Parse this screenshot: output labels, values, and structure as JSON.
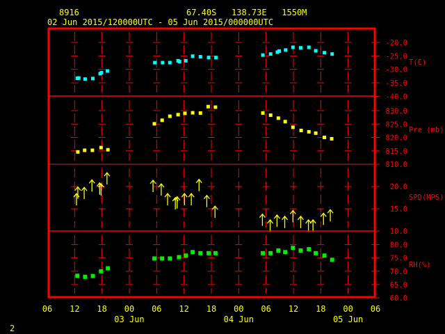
{
  "header": {
    "station": "8916",
    "location": "67.40S   138.73E   1550M",
    "period": "02 Jun 2015/120000UTC - 05 Jun 2015/000000UTC"
  },
  "footer": {
    "page": "2"
  },
  "colors": {
    "frame": "#ff0000",
    "temp": "#00ffff",
    "pres": "#ffff00",
    "wind": "#ffff00",
    "rh": "#00ee00",
    "text": "#ffff00"
  },
  "chart_data": {
    "type": "scatter",
    "title": "8916  67.40S 138.73E 1550M",
    "x_unit": "hours since 02 Jun 2015 06 UTC",
    "xlim": [
      0,
      72
    ],
    "x_ticks": [
      "06",
      "12",
      "18",
      "00",
      "06",
      "12",
      "18",
      "00",
      "06",
      "12",
      "18",
      "00",
      "06"
    ],
    "date_labels": [
      {
        "hour": 18,
        "label": "03 Jun"
      },
      {
        "hour": 42,
        "label": "04 Jun"
      },
      {
        "hour": 66,
        "label": "05 Jun"
      }
    ],
    "panels": [
      {
        "key": "temp",
        "label": "T(C)",
        "ylim": [
          -40,
          -17.5
        ],
        "ticks": [
          "-20.0",
          "-25.0",
          "-30.0",
          "-35.0",
          "-40.0"
        ],
        "tick_values": [
          -20,
          -25,
          -30,
          -35,
          -40
        ],
        "x": [
          6.6,
          6.9,
          8.3,
          10.0,
          11.6,
          11.9,
          13.2,
          23.6,
          25.3,
          26.9,
          28.7,
          29.0,
          30.4,
          31.9,
          33.6,
          35.4,
          37.0,
          47.3,
          49.0,
          50.5,
          50.9,
          52.3,
          53.9,
          55.6,
          57.4,
          58.9,
          60.8,
          62.5
        ],
        "y": [
          -33.3,
          -33.2,
          -33.6,
          -33.4,
          -31.6,
          -31.2,
          -30.6,
          -27.5,
          -27.5,
          -27.5,
          -26.8,
          -27.1,
          -26.8,
          -25.1,
          -25.3,
          -25.6,
          -25.6,
          -24.7,
          -24.3,
          -23.6,
          -23.2,
          -22.8,
          -21.8,
          -22.0,
          -21.8,
          -23.1,
          -23.8,
          -24.3
        ]
      },
      {
        "key": "pres",
        "label": "Pre (mb)",
        "ylim": [
          810,
          835
        ],
        "ticks": [
          "830.0",
          "825.0",
          "820.0",
          "815.0",
          "810.0"
        ],
        "tick_values": [
          830,
          825,
          820,
          815,
          810
        ],
        "x": [
          6.7,
          8.2,
          9.9,
          11.8,
          13.3,
          23.5,
          25.2,
          26.9,
          28.7,
          30.2,
          31.9,
          33.6,
          35.3,
          36.9,
          47.3,
          49.0,
          50.7,
          52.2,
          53.9,
          55.7,
          57.4,
          58.9,
          60.8,
          62.4
        ],
        "y": [
          814.6,
          815.2,
          815.2,
          816.2,
          815.4,
          825.1,
          826.4,
          827.9,
          828.5,
          829.0,
          829.2,
          829.1,
          831.5,
          831.3,
          829.1,
          828.3,
          827.2,
          825.9,
          823.8,
          822.6,
          822.1,
          821.6,
          820.0,
          819.5
        ]
      },
      {
        "key": "wind",
        "label": "SPD(MPS)",
        "ylim": [
          10,
          25
        ],
        "ticks": [
          "20.0",
          "15.0",
          "10.0"
        ],
        "tick_values": [
          20,
          15,
          10
        ],
        "x": [
          6.4,
          6.7,
          8.1,
          9.8,
          11.5,
          11.8,
          13.1,
          23.2,
          25.0,
          26.4,
          28.1,
          28.5,
          30.1,
          31.6,
          33.3,
          35.0,
          36.8,
          47.2,
          48.9,
          50.4,
          52.1,
          53.9,
          55.6,
          57.3,
          58.3,
          60.6,
          62.1
        ],
        "y": [
          17.0,
          18.5,
          18.4,
          20.1,
          19.4,
          19.2,
          21.7,
          20.0,
          19.2,
          17.0,
          16.1,
          16.3,
          17.0,
          17.0,
          20.2,
          16.6,
          14.2,
          12.4,
          11.1,
          12.2,
          11.9,
          13.2,
          11.9,
          11.1,
          11.1,
          12.6,
          13.4
        ]
      },
      {
        "key": "rh",
        "label": "RH(%)",
        "ylim": [
          60,
          85
        ],
        "ticks": [
          "80.0",
          "75.0",
          "70.0",
          "65.0",
          "60.0"
        ],
        "tick_values": [
          80,
          75,
          70,
          65,
          60
        ],
        "x": [
          6.6,
          8.3,
          10.0,
          11.8,
          13.3,
          23.5,
          25.2,
          26.9,
          28.9,
          30.4,
          31.9,
          33.6,
          35.4,
          36.9,
          47.3,
          49.0,
          50.7,
          52.2,
          53.9,
          55.6,
          57.4,
          58.9,
          60.8,
          62.5
        ],
        "y": [
          68.3,
          67.9,
          68.2,
          70.0,
          71.1,
          74.8,
          74.8,
          74.8,
          75.3,
          75.9,
          77.2,
          76.8,
          76.8,
          76.8,
          76.8,
          76.8,
          77.8,
          77.2,
          78.8,
          77.8,
          78.3,
          76.8,
          75.9,
          74.3
        ]
      }
    ]
  }
}
